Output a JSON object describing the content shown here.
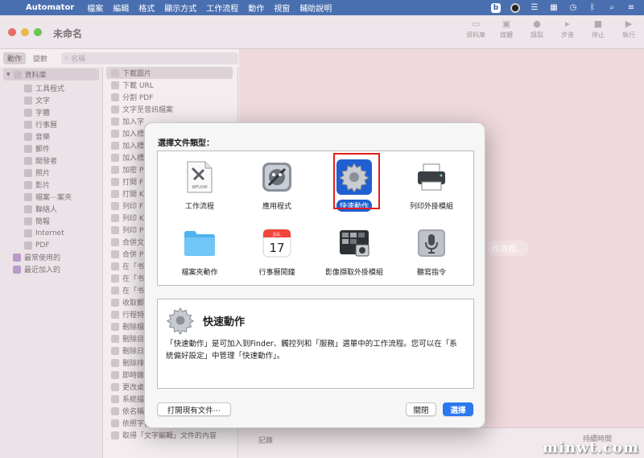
{
  "menubar": {
    "app": "Automator",
    "items": [
      "檔案",
      "編輯",
      "格式",
      "顯示方式",
      "工作流程",
      "動作",
      "視窗",
      "輔助說明"
    ]
  },
  "window": {
    "title": "未命名",
    "toolbar": [
      "資料庫",
      "媒體",
      "錄製",
      "步進",
      "停止",
      "執行"
    ]
  },
  "sidebar": {
    "tabs": [
      "動作",
      "變數"
    ],
    "search_placeholder": "名稱",
    "library_root": "資料庫",
    "library": [
      "工具程式",
      "文字",
      "字體",
      "行事曆",
      "音樂",
      "郵件",
      "開發者",
      "照片",
      "影片",
      "檔案⋯案夾",
      "聯絡人",
      "簡報",
      "Internet",
      "PDF"
    ],
    "smart": [
      "最常使用的",
      "最近加入的"
    ]
  },
  "actions": [
    "下載圖片",
    "下載 URL",
    "分割 PDF",
    "文字至音訊檔案",
    "加入字",
    "加入標",
    "加入標",
    "加入標",
    "加密 P",
    "打開 F",
    "打開 K",
    "列印 F",
    "列印 K",
    "列印 P",
    "合併文",
    "合併 P",
    "在「书",
    "在「书",
    "在「书",
    "收取郵",
    "行程特",
    "刪除檔",
    "刪除目",
    "刪除日",
    "刪除排",
    "即時錄",
    "更改桌",
    "系統描",
    "依名稱",
    "依照字體類型選擇字體",
    "取得「文字編輯」文件的內容"
  ],
  "workflow": {
    "hint": "作流程。",
    "log_label": "記錄",
    "duration_label": "持續時間"
  },
  "dialog": {
    "title": "選擇文件類型：",
    "types": [
      {
        "label": "工作流程"
      },
      {
        "label": "應用程式"
      },
      {
        "label": "快速動作",
        "selected": true
      },
      {
        "label": "列印外掛模組"
      },
      {
        "label": "檔案夾動作"
      },
      {
        "label": "行事曆鬧鐘",
        "cal_month": "JUL",
        "cal_day": "17"
      },
      {
        "label": "影像擷取外掛模組"
      },
      {
        "label": "聽寫指令"
      }
    ],
    "workflow_doc_text": "WFLOW",
    "desc_title": "快速動作",
    "desc_text": "「快速動作」是可加入到Finder、觸控列和「服務」選單中的工作流程。您可以在「系統偏好設定」中管理「快速動作」。",
    "open_existing": "打開現有文件⋯",
    "close": "關閉",
    "choose": "選擇"
  },
  "watermark": "minwt.com",
  "colors": {
    "menubar": "#4a6fb0",
    "accent": "#2b78f0",
    "selection": "#1f5fd1",
    "highlight_box": "#e31c1c"
  }
}
